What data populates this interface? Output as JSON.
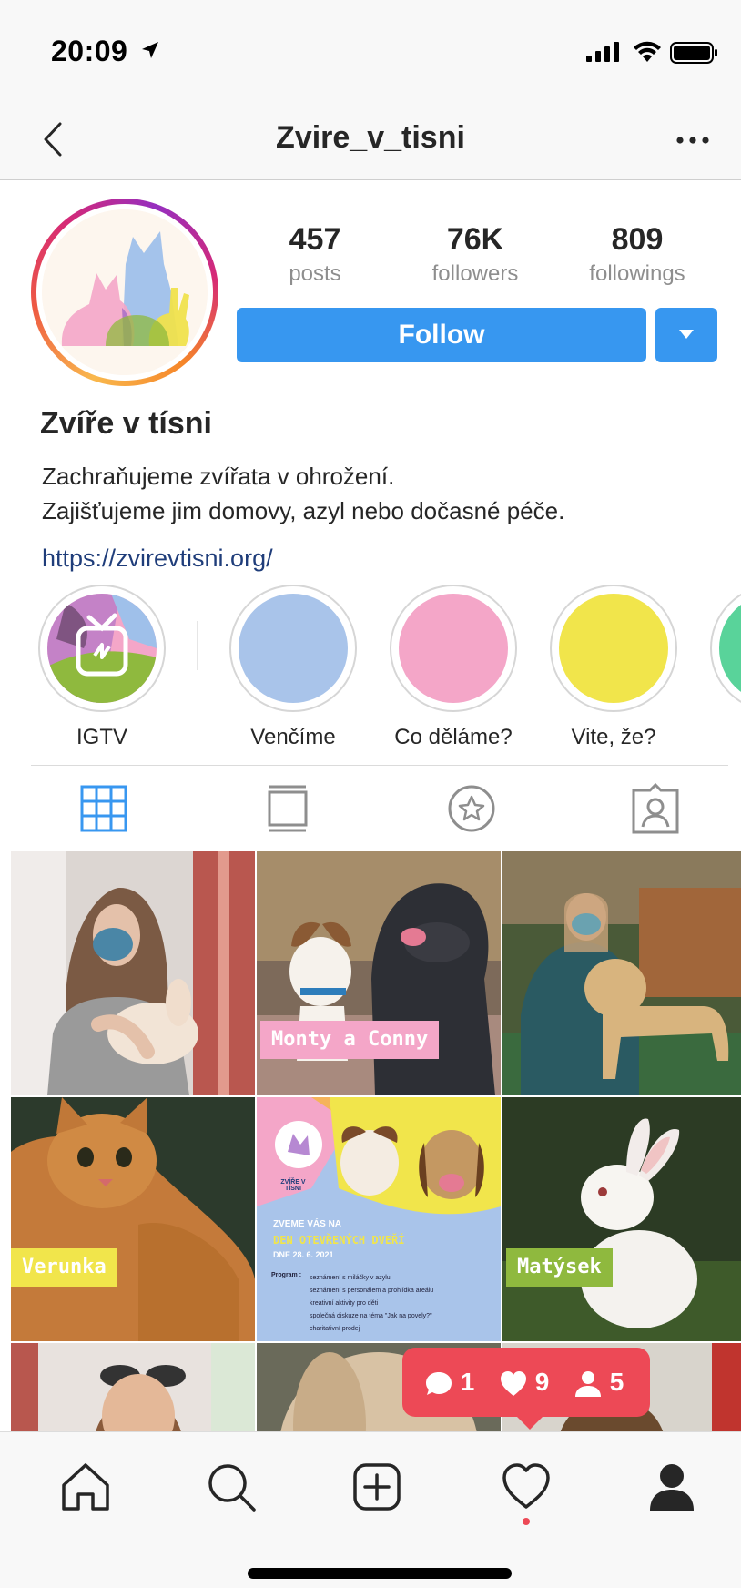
{
  "status_bar": {
    "time": "20:09"
  },
  "nav": {
    "title": "Zvire_v_tisni"
  },
  "profile": {
    "stats": [
      {
        "value": "457",
        "label": "posts"
      },
      {
        "value": "76K",
        "label": "followers"
      },
      {
        "value": "809",
        "label": "followings"
      }
    ],
    "follow_label": "Follow",
    "display_name": "Zvíře v tísni",
    "bio_line1": "Zachraňujeme zvířata v ohrožení.",
    "bio_line2": "Zajišťujeme jim domovy, azyl nebo dočasné péče.",
    "link": "https://zvirevtisni.org/"
  },
  "highlights": [
    {
      "label": "IGTV",
      "icon": "igtv-icon"
    },
    {
      "label": "Venčíme",
      "color": "#a9c4ea"
    },
    {
      "label": "Co děláme?",
      "color": "#f4a6c8"
    },
    {
      "label": "Vite, že?",
      "color": "#f1e54b"
    },
    {
      "label": "",
      "color": "#59d39a"
    }
  ],
  "tabs": [
    "grid-icon",
    "feed-icon",
    "saved-star-icon",
    "tagged-icon"
  ],
  "grid": {
    "tags": {
      "monty": "Monty a Conny",
      "verunka": "Verunka",
      "matysek": "Matýsek"
    },
    "poster": {
      "logo_text": "ZVÍŘE V TÍSNI",
      "line1": "ZVEME VÁS NA",
      "line2": "DEN OTEVŘENÝCH DVEŘÍ",
      "line3": "DNE 28. 6. 2021",
      "program_label": "Program :",
      "program_items": [
        "seznámení s miláčky v azylu",
        "seznámení s personálem a prohlídka areálu",
        "kreativní aktivity pro děti",
        "společná diskuze na téma \"Jak na povely?\"",
        "charitativní prodej"
      ]
    }
  },
  "notification": {
    "comments": "1",
    "likes": "9",
    "follows": "5"
  },
  "colors": {
    "accent": "#3797f0",
    "notification": "#ed4956",
    "link": "#1f3d7a"
  }
}
